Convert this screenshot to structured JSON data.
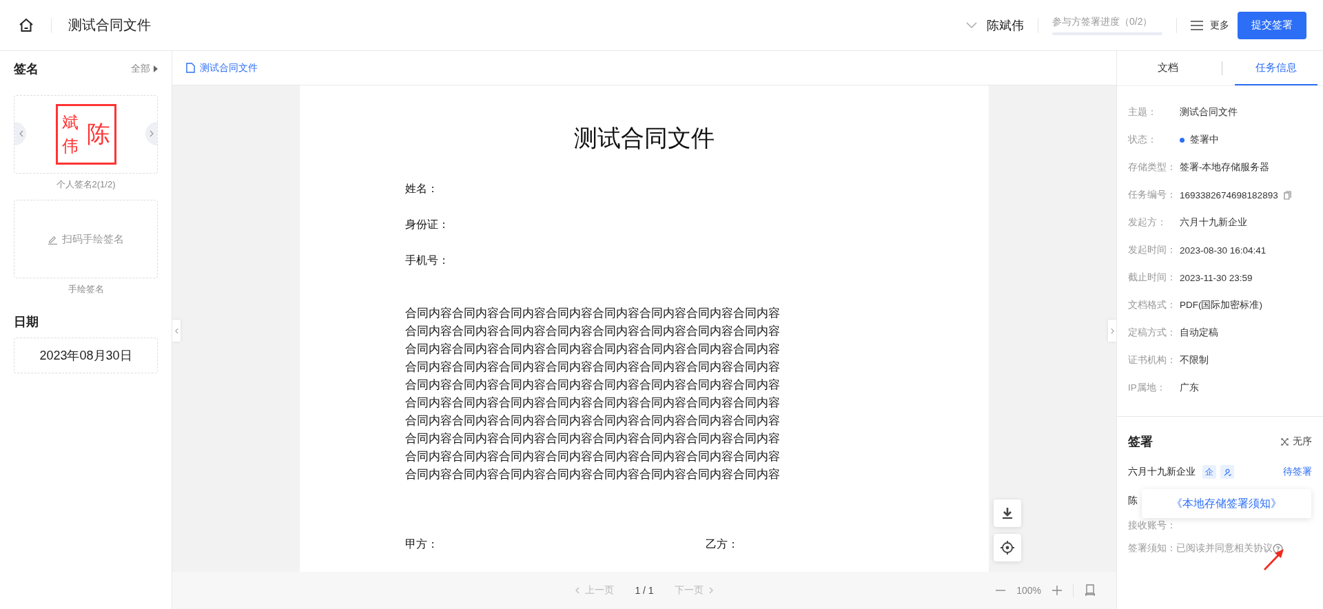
{
  "header": {
    "title": "测试合同文件",
    "user": "陈斌伟",
    "progress": {
      "label": "参与方签署进度（0/2）",
      "level": 0
    },
    "more": "更多",
    "submit": "提交签署"
  },
  "sidebar": {
    "title": "签名",
    "all": "全部",
    "signatures": [
      {
        "kind": "stamp",
        "chars": [
          "陈",
          "斌",
          "伟"
        ],
        "caption": "个人签名2(1/2)"
      },
      {
        "kind": "scan",
        "label": "扫码手绘签名",
        "caption": "手绘签名"
      }
    ],
    "date_title": "日期",
    "date": "2023年08月30日"
  },
  "document": {
    "tab": "测试合同文件",
    "title": "测试合同文件",
    "fields": [
      "姓名：",
      "身份证：",
      "手机号："
    ],
    "lines": [
      "合同内容合同内容合同内容合同内容合同内容合同内容合同内容合同内容",
      "合同内容合同内容合同内容合同内容合同内容合同内容合同内容合同内容",
      "合同内容合同内容合同内容合同内容合同内容合同内容合同内容合同内容",
      "合同内容合同内容合同内容合同内容合同内容合同内容合同内容合同内容",
      "合同内容合同内容合同内容合同内容合同内容合同内容合同内容合同内容",
      "合同内容合同内容合同内容合同内容合同内容合同内容合同内容合同内容",
      "合同内容合同内容合同内容合同内容合同内容合同内容合同内容合同内容",
      "合同内容合同内容合同内容合同内容合同内容合同内容合同内容合同内容",
      "合同内容合同内容合同内容合同内容合同内容合同内容合同内容合同内容",
      "合同内容合同内容合同内容合同内容合同内容合同内容合同内容合同内容"
    ],
    "party_a": "甲方：",
    "party_b": "乙方："
  },
  "pager": {
    "prev": "上一页",
    "page": "1 / 1",
    "next": "下一页",
    "zoom": "100%"
  },
  "panel": {
    "tabs": [
      {
        "label": "文档",
        "selected": false
      },
      {
        "label": "任务信息",
        "selected": true
      }
    ],
    "info": [
      {
        "label": "主题：",
        "value": "测试合同文件"
      },
      {
        "label": "状态：",
        "value": "签署中",
        "color": "#2c6ef5"
      },
      {
        "label": "存储类型：",
        "value": "签署-本地存储服务器"
      },
      {
        "label": "任务编号：",
        "value": "1693382674698182893",
        "copy": true
      },
      {
        "label": "发起方：",
        "value": "六月十九新企业"
      },
      {
        "label": "发起时间：",
        "value": "2023-08-30 16:04:41"
      },
      {
        "label": "截止时间：",
        "value": "2023-11-30 23:59"
      },
      {
        "label": "文档格式：",
        "value": "PDF(国际加密标准)"
      },
      {
        "label": "定稿方式：",
        "value": "自动定稿"
      },
      {
        "label": "证书机构：",
        "value": "不限制"
      },
      {
        "label": "IP属地：",
        "value": "广东"
      }
    ],
    "signing": {
      "title": "签署",
      "order": "无序",
      "party": {
        "name": "六月十九新企业",
        "badge": "企",
        "status": "待签署"
      },
      "signer": "陈",
      "account_label": "接收账号：",
      "notice_label": "签署须知：",
      "notice": "已阅读并同意相关协议"
    },
    "popover": "《本地存储签署须知》"
  }
}
